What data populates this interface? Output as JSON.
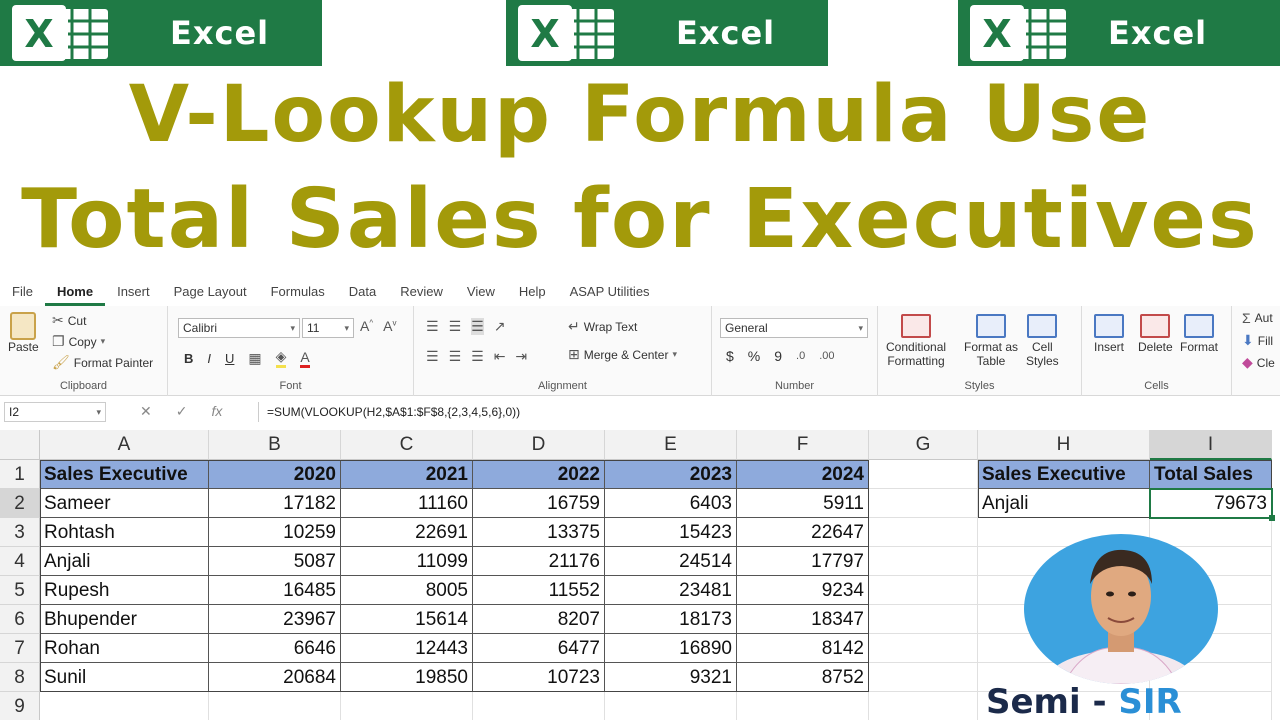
{
  "banners": [
    {
      "logo": "excel-logo",
      "text": "Excel"
    },
    {
      "logo": "excel-logo",
      "text": "Excel"
    },
    {
      "logo": "excel-logo",
      "text": "Excel"
    }
  ],
  "titles": {
    "line1": "V-Lookup Formula Use",
    "line2": "Total Sales for Executives"
  },
  "ribbon": {
    "tabs": [
      "File",
      "Home",
      "Insert",
      "Page Layout",
      "Formulas",
      "Data",
      "Review",
      "View",
      "Help",
      "ASAP Utilities"
    ],
    "active_tab": "Home",
    "clipboard": {
      "paste": "Paste",
      "cut": "Cut",
      "copy": "Copy",
      "format_painter": "Format Painter",
      "label": "Clipboard"
    },
    "font": {
      "name": "Calibri",
      "size": "11",
      "label": "Font",
      "bold": "B",
      "italic": "I",
      "underline": "U"
    },
    "alignment": {
      "wrap": "Wrap Text",
      "merge": "Merge & Center",
      "label": "Alignment"
    },
    "number": {
      "format": "General",
      "label": "Number",
      "currency": "$",
      "percent": "%",
      "comma": "9"
    },
    "styles": {
      "conditional": "Conditional",
      "conditional2": "Formatting",
      "format_as": "Format as",
      "format_as2": "Table",
      "cell": "Cell",
      "cell2": "Styles",
      "label": "Styles"
    },
    "cells": {
      "insert": "Insert",
      "delete": "Delete",
      "format": "Format",
      "label": "Cells"
    },
    "editing": {
      "autosum": "Aut",
      "fill": "Fill",
      "clear": "Cle"
    }
  },
  "formula_bar": {
    "name_box": "I2",
    "formula": "=SUM(VLOOKUP(H2,$A$1:$F$8,{2,3,4,5,6},0))"
  },
  "sheet": {
    "columns": [
      "A",
      "B",
      "C",
      "D",
      "E",
      "F",
      "G",
      "H",
      "I"
    ],
    "rows": [
      "1",
      "2",
      "3",
      "4",
      "5",
      "6",
      "7",
      "8",
      "9"
    ],
    "header": [
      "Sales Executive",
      "2020",
      "2021",
      "2022",
      "2023",
      "2024"
    ],
    "data": [
      [
        "Sameer",
        "17182",
        "11160",
        "16759",
        "6403",
        "5911"
      ],
      [
        "Rohtash",
        "10259",
        "22691",
        "13375",
        "15423",
        "22647"
      ],
      [
        "Anjali",
        "5087",
        "11099",
        "21176",
        "24514",
        "17797"
      ],
      [
        "Rupesh",
        "16485",
        "8005",
        "11552",
        "23481",
        "9234"
      ],
      [
        "Bhupender",
        "23967",
        "15614",
        "8207",
        "18173",
        "18347"
      ],
      [
        "Rohan",
        "6646",
        "12443",
        "6477",
        "16890",
        "8142"
      ],
      [
        "Sunil",
        "20684",
        "19850",
        "10723",
        "9321",
        "8752"
      ]
    ],
    "lookup": {
      "header_h": "Sales Executive",
      "header_i": "Total Sales",
      "value_h": "Anjali",
      "value_i": "79673"
    }
  },
  "brand": {
    "part1": "Semi - ",
    "part2": "SIR"
  },
  "colors": {
    "excel_green": "#1f7a45",
    "title_olive": "#a39a0a",
    "header_blue": "#8eaadc",
    "avatar_blue": "#3da3e0"
  }
}
